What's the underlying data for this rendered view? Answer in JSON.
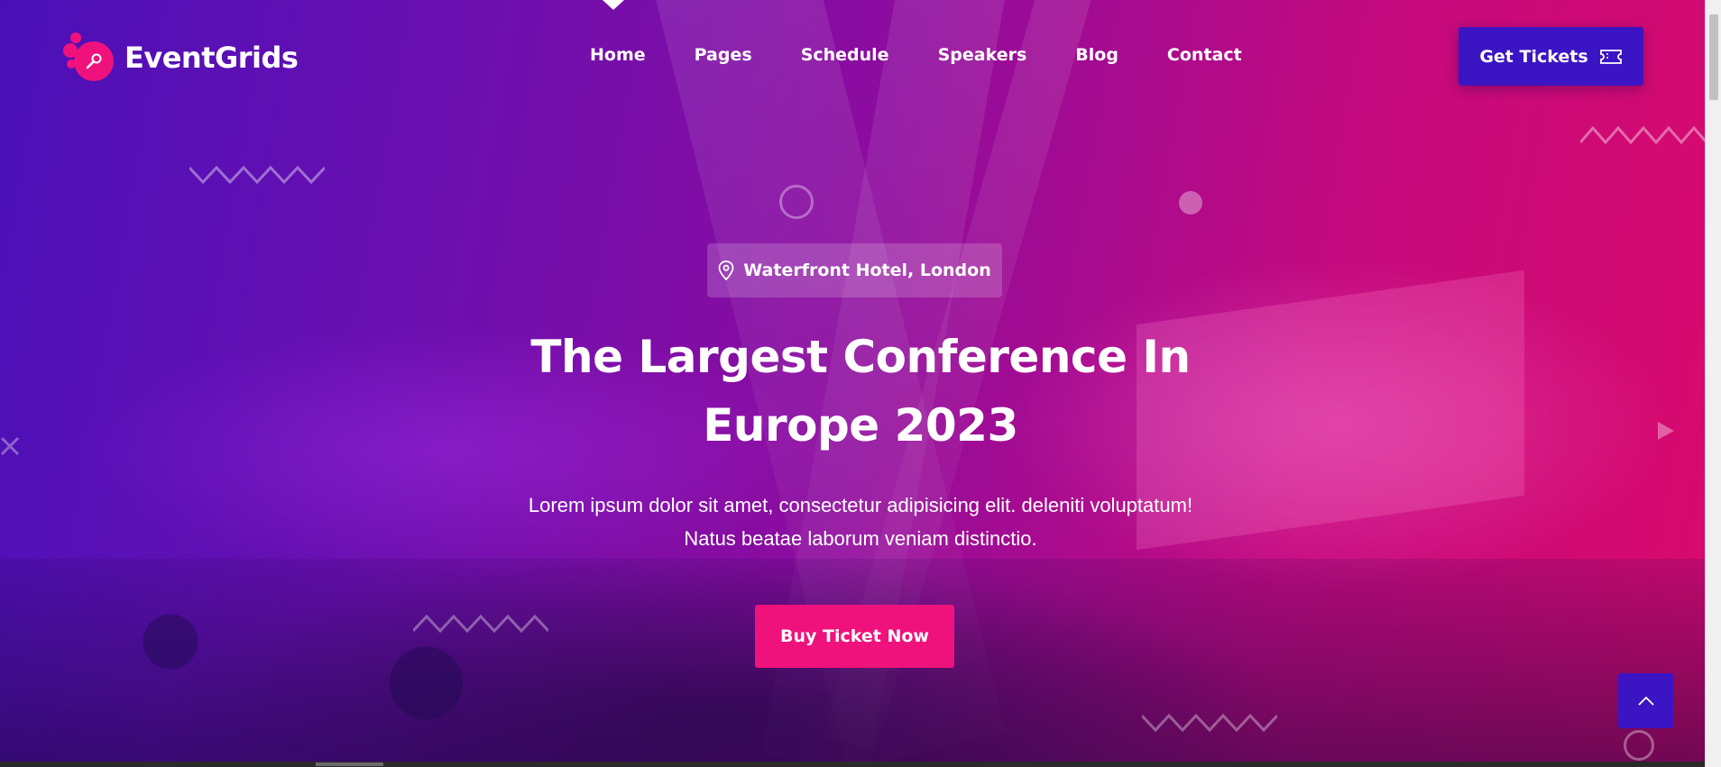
{
  "brand": {
    "name": "EventGrids",
    "accent": "#f0127c",
    "primary": "#3b14c4"
  },
  "nav": {
    "items": [
      "Home",
      "Pages",
      "Schedule",
      "Speakers",
      "Blog",
      "Contact"
    ],
    "active": "Home"
  },
  "header": {
    "cta_label": "Get Tickets",
    "cta_icon": "ticket-icon"
  },
  "hero": {
    "location_icon": "map-pin-icon",
    "location": "Waterfront Hotel, London",
    "headline_line1": "The Largest Conference In",
    "headline_line2": "Europe 2023",
    "subtext_line1": "Lorem ipsum dolor sit amet, consectetur adipisicing elit. deleniti voluptatum!",
    "subtext_line2": "Natus beatae laborum veniam distinctio.",
    "button_label": "Buy Ticket Now"
  },
  "scroll_top": {
    "icon": "chevron-up-icon"
  }
}
